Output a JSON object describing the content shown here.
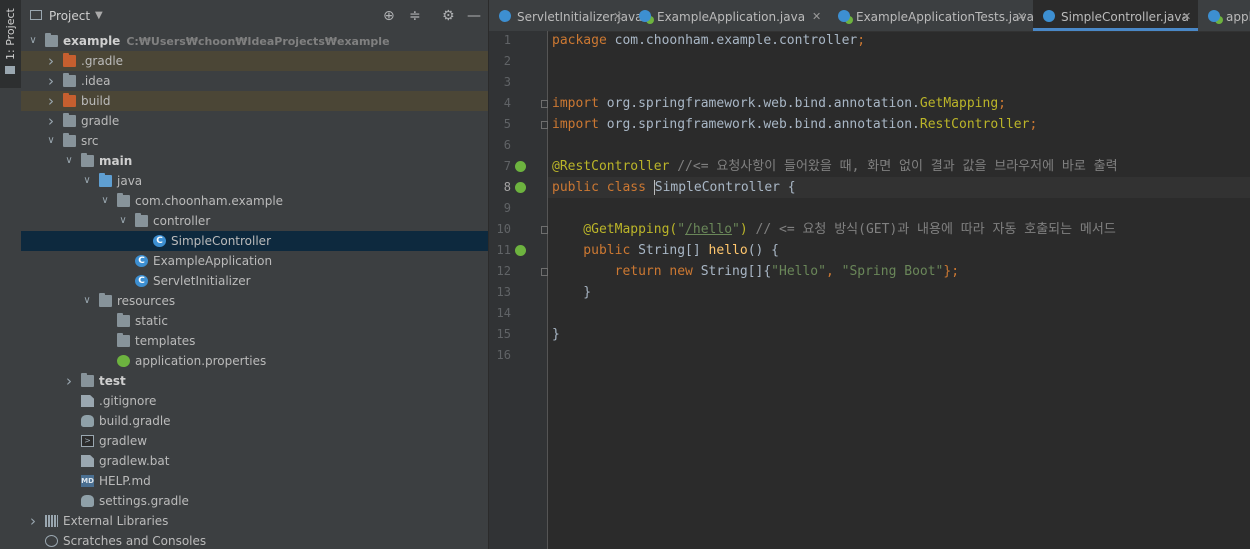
{
  "stripe": {
    "label": "1: Project"
  },
  "project_panel": {
    "title": "Project",
    "tree": [
      {
        "label": "example",
        "path": "C:₩Users₩choon₩IdeaProjects₩example",
        "depth": 0,
        "arrow": "down",
        "icon": "module",
        "bold": true
      },
      {
        "label": ".gradle",
        "depth": 1,
        "arrow": "right",
        "icon": "folder-orange",
        "highlight": true
      },
      {
        "label": ".idea",
        "depth": 1,
        "arrow": "right",
        "icon": "folder-gray"
      },
      {
        "label": "build",
        "depth": 1,
        "arrow": "right",
        "icon": "folder-orange",
        "highlight": true
      },
      {
        "label": "gradle",
        "depth": 1,
        "arrow": "right",
        "icon": "folder-gray"
      },
      {
        "label": "src",
        "depth": 1,
        "arrow": "down",
        "icon": "folder-gray"
      },
      {
        "label": "main",
        "depth": 2,
        "arrow": "down",
        "icon": "folder-gray",
        "bold": true
      },
      {
        "label": "java",
        "depth": 3,
        "arrow": "down",
        "icon": "folder-blue"
      },
      {
        "label": "com.choonham.example",
        "depth": 4,
        "arrow": "down",
        "icon": "package"
      },
      {
        "label": "controller",
        "depth": 5,
        "arrow": "down",
        "icon": "package"
      },
      {
        "label": "SimpleController",
        "depth": 6,
        "arrow": "",
        "icon": "class",
        "selected": true
      },
      {
        "label": "ExampleApplication",
        "depth": 5,
        "arrow": "",
        "icon": "spring-class"
      },
      {
        "label": "ServletInitializer",
        "depth": 5,
        "arrow": "",
        "icon": "class"
      },
      {
        "label": "resources",
        "depth": 3,
        "arrow": "down",
        "icon": "folder-res"
      },
      {
        "label": "static",
        "depth": 4,
        "arrow": "",
        "icon": "folder-gray"
      },
      {
        "label": "templates",
        "depth": 4,
        "arrow": "",
        "icon": "folder-gray"
      },
      {
        "label": "application.properties",
        "depth": 4,
        "arrow": "",
        "icon": "spring-file"
      },
      {
        "label": "test",
        "depth": 2,
        "arrow": "right",
        "icon": "folder-gray",
        "bold": true
      },
      {
        "label": ".gitignore",
        "depth": 2,
        "arrow": "",
        "icon": "doc"
      },
      {
        "label": "build.gradle",
        "depth": 2,
        "arrow": "",
        "icon": "gradle"
      },
      {
        "label": "gradlew",
        "depth": 2,
        "arrow": "",
        "icon": "terminal"
      },
      {
        "label": "gradlew.bat",
        "depth": 2,
        "arrow": "",
        "icon": "doc"
      },
      {
        "label": "HELP.md",
        "depth": 2,
        "arrow": "",
        "icon": "md"
      },
      {
        "label": "settings.gradle",
        "depth": 2,
        "arrow": "",
        "icon": "gradle"
      },
      {
        "label": "External Libraries",
        "depth": 0,
        "arrow": "right",
        "icon": "libraries"
      },
      {
        "label": "Scratches and Consoles",
        "depth": 0,
        "arrow": "",
        "icon": "scratch"
      }
    ]
  },
  "tabs": [
    {
      "label": "ServletInitializer.java",
      "close": "✕"
    },
    {
      "label": "ExampleApplication.java",
      "close": "✕"
    },
    {
      "label": "ExampleApplicationTests.java",
      "close": "✕"
    },
    {
      "label": "SimpleController.java",
      "close": "✕",
      "active": true
    },
    {
      "label": "appl",
      "close": ""
    }
  ],
  "editor": {
    "current_line": 8,
    "lines": [
      [
        {
          "t": "package ",
          "c": "kw"
        },
        {
          "t": "com.choonham.example.controller",
          "c": ""
        },
        {
          "t": ";",
          "c": "kw"
        }
      ],
      [],
      [],
      [
        {
          "t": "import ",
          "c": "kw"
        },
        {
          "t": "org.springframework.web.bind.annotation.",
          "c": ""
        },
        {
          "t": "GetMapping",
          "c": "an"
        },
        {
          "t": ";",
          "c": "kw"
        }
      ],
      [
        {
          "t": "import ",
          "c": "kw"
        },
        {
          "t": "org.springframework.web.bind.annotation.",
          "c": ""
        },
        {
          "t": "RestController",
          "c": "an"
        },
        {
          "t": ";",
          "c": "kw"
        }
      ],
      [],
      [
        {
          "t": "@RestController ",
          "c": "an"
        },
        {
          "t": "//<= 요청사항이 들어왔을 때, 화면 없이 결과 값을 브라우저에 바로 출력",
          "c": "cm"
        }
      ],
      [
        {
          "t": "public class ",
          "c": "kw"
        },
        {
          "t": "SimpleController",
          "c": "cursor"
        },
        {
          "t": " {",
          "c": ""
        }
      ],
      [],
      [
        {
          "t": "    @GetMapping(",
          "c": "an"
        },
        {
          "t": "\"",
          "c": "st"
        },
        {
          "t": "/hello",
          "c": "url"
        },
        {
          "t": "\"",
          "c": "st"
        },
        {
          "t": ") ",
          "c": "an"
        },
        {
          "t": "// <= 요청 방식(GET)과 내용에 따라 자동 호출되는 메서드",
          "c": "cm"
        }
      ],
      [
        {
          "t": "    public ",
          "c": "kw"
        },
        {
          "t": "String[] ",
          "c": ""
        },
        {
          "t": "hello",
          "c": "fn"
        },
        {
          "t": "() {",
          "c": ""
        }
      ],
      [
        {
          "t": "        return new ",
          "c": "kw"
        },
        {
          "t": "String[]{",
          "c": ""
        },
        {
          "t": "\"Hello\"",
          "c": "st"
        },
        {
          "t": ", ",
          "c": "kw"
        },
        {
          "t": "\"Spring Boot\"",
          "c": "st"
        },
        {
          "t": "};",
          "c": "kw"
        }
      ],
      [
        {
          "t": "    }",
          "c": ""
        }
      ],
      [],
      [
        {
          "t": "}",
          "c": ""
        }
      ],
      []
    ],
    "gutter_marks": [
      7,
      8,
      11
    ],
    "fold_marks": [
      4,
      5,
      10,
      12
    ]
  }
}
